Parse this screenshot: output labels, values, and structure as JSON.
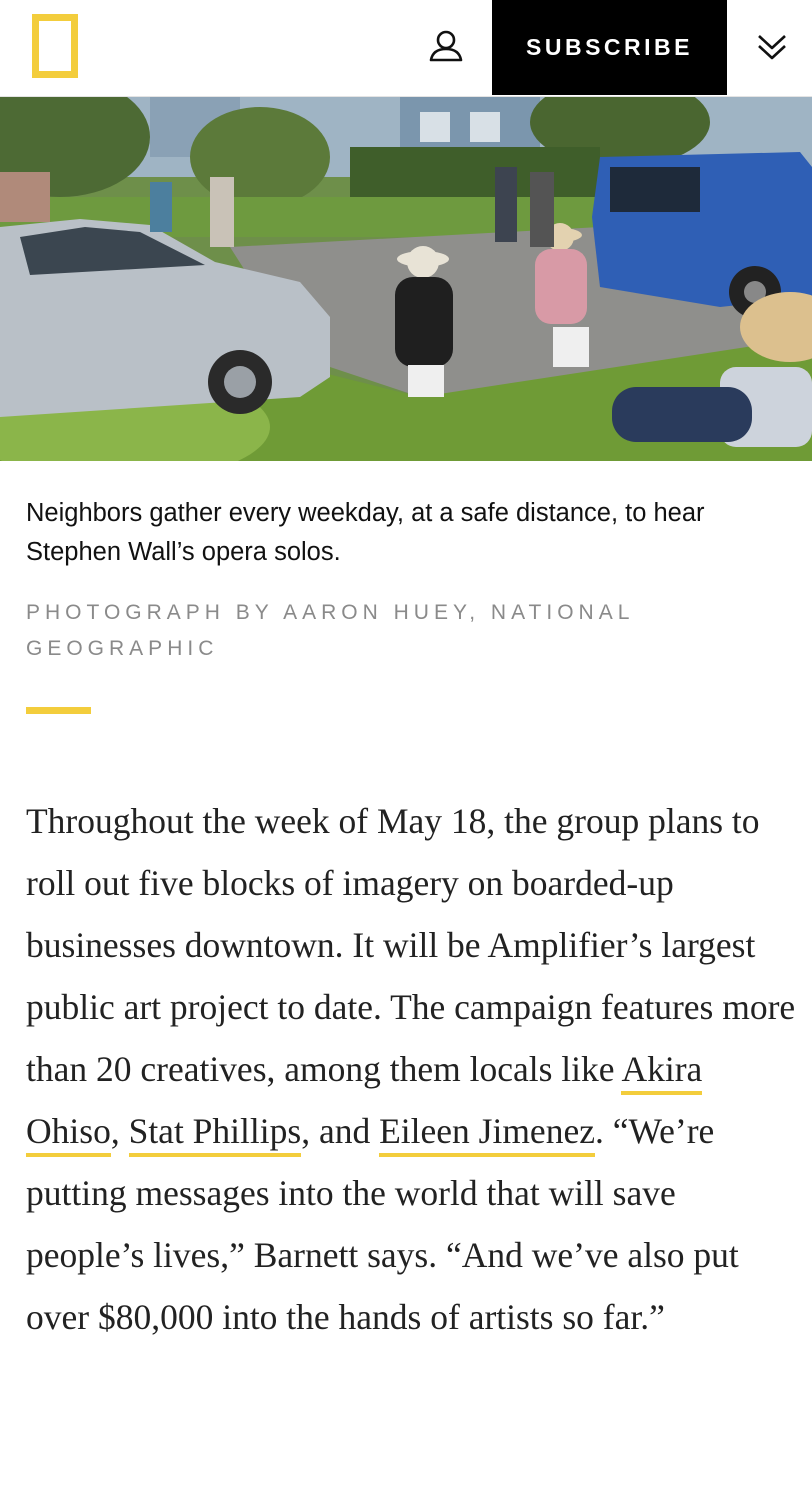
{
  "header": {
    "logo_icon": "nat-geo-yellow-border-logo",
    "user_icon": "user-account-icon",
    "subscribe_label": "SUBSCRIBE",
    "menu_icon": "double-chevron-down-icon",
    "brand_color": "#f3cd3c"
  },
  "photo": {
    "caption": "Neighbors gather every weekday, at a safe distance, to hear Stephen Wall’s opera solos.",
    "credit": "PHOTOGRAPH BY AARON HUEY, NATIONAL GEOGRAPHIC"
  },
  "article": {
    "p1_part1": "Throughout the week of May 18, the group plans to roll out five blocks of imagery on boarded-up businesses downtown. It will be Amplifier’s largest public art project to date. The campaign features more than 20 creatives, among them locals like ",
    "link1": "Akira Ohiso",
    "sep1": ", ",
    "link2": "Stat Phillips",
    "sep2": ", and ",
    "link3": "Eileen Jimenez",
    "p1_part2": ". “We’re putting messages into the world that will save people’s lives,” Barnett says. “And we’ve also put over $80,000 into the hands of artists so far.”"
  }
}
